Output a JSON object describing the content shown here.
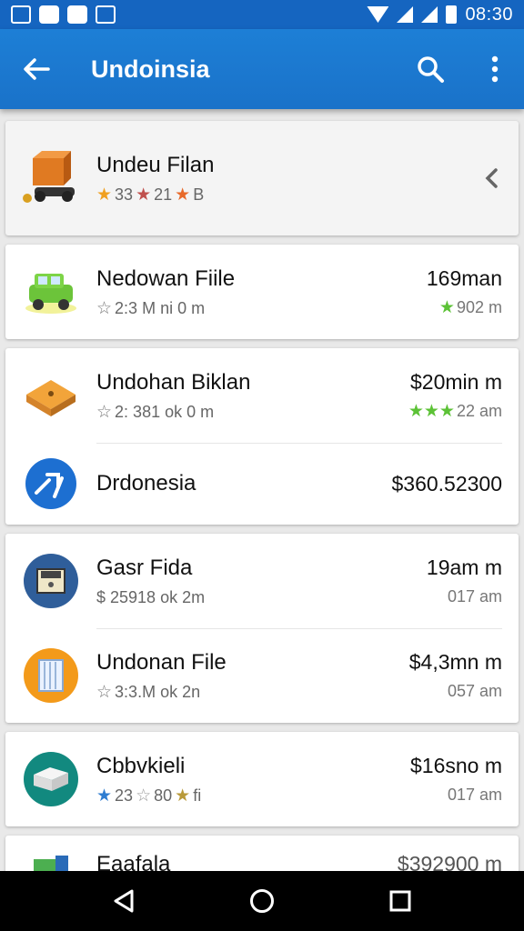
{
  "status_bar": {
    "time": "08:30",
    "icons": [
      "gallery-icon",
      "notification-icon",
      "app-icon",
      "photo-icon",
      "wifi-icon",
      "signal-icon",
      "signal-icon",
      "battery-icon"
    ]
  },
  "app_bar": {
    "title": "Undoinsia",
    "back_icon": "back-arrow-icon",
    "search_icon": "search-icon",
    "menu_icon": "more-vert-icon"
  },
  "items": [
    {
      "name": "Undeu Filan",
      "sub": "33",
      "sub2": "21",
      "sub3": "B",
      "icon": "truck-icon",
      "featured": true
    },
    {
      "name": "Nedowan Fiile",
      "sub": "2:3 M ni 0 m",
      "price": "169man",
      "meta": "902 m",
      "icon": "car-icon"
    },
    {
      "name": "Undohan Biklan",
      "sub": "2: 381 ok 0 m",
      "price": "$20min m",
      "meta": "22 am",
      "icon": "box-icon"
    },
    {
      "name": "Drdonesia",
      "price": "$360.52300",
      "icon": "circle-app-icon"
    },
    {
      "name": "Gasr Fida",
      "sub": "$ 25918 ok 2m",
      "price": "19am m",
      "meta": "017 am",
      "icon": "package-icon"
    },
    {
      "name": "Undonan File",
      "sub": "3:3.M ok 2n",
      "price": "$4,3mn m",
      "meta": "057 am",
      "icon": "document-icon"
    },
    {
      "name": "Cbbvkieli",
      "sub": "23",
      "sub2": "80",
      "sub3": "fi",
      "price": "$16sno m",
      "meta": "017 am",
      "icon": "box-icon"
    },
    {
      "name": "Eaafala",
      "price": "$392900 m",
      "icon": "green-icon"
    }
  ],
  "colors": {
    "primary": "#1a72c9",
    "status": "#1565c0",
    "star_orange": "#f0a020",
    "star_green": "#5cc236",
    "star_blue": "#2f7dd1"
  }
}
